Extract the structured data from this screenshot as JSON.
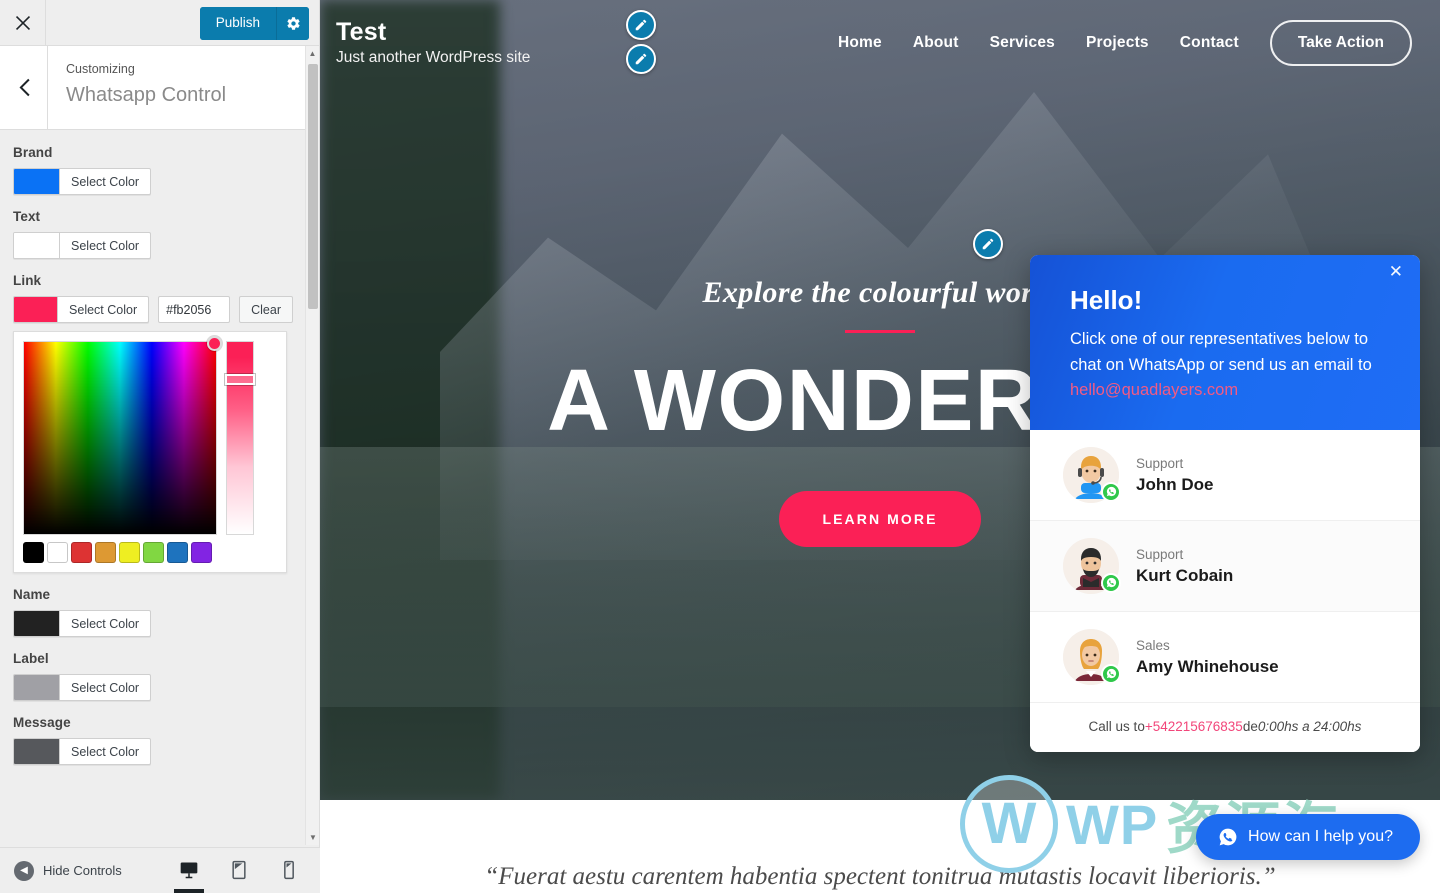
{
  "customizer": {
    "close_icon": "close-icon",
    "publish_label": "Publish",
    "gear_icon": "gear-icon",
    "back_icon": "chevron-left-icon",
    "breadcrumb": "Customizing",
    "panel_title": "Whatsapp Control",
    "select_color_label": "Select Color",
    "clear_label": "Clear",
    "controls": [
      {
        "label": "Brand",
        "color": "#0a72f5",
        "hex": "",
        "has_hex": false
      },
      {
        "label": "Text",
        "color": "#ffffff",
        "hex": "",
        "has_hex": false
      },
      {
        "label": "Link",
        "color": "#fb2056",
        "hex": "#fb2056",
        "has_hex": true
      },
      {
        "label": "Name",
        "color": "#222222",
        "hex": "",
        "has_hex": false
      },
      {
        "label": "Label",
        "color": "#a0a0a5",
        "hex": "",
        "has_hex": false
      },
      {
        "label": "Message",
        "color": "#56585c",
        "hex": "",
        "has_hex": false
      }
    ],
    "picker": {
      "current_color": "#fb2056",
      "swatches": [
        "#000000",
        "#ffffff",
        "#dd3333",
        "#dd9933",
        "#eeee22",
        "#81d742",
        "#1e73be",
        "#8224e3"
      ]
    },
    "footer": {
      "hide_controls_label": "Hide Controls",
      "devices": [
        {
          "name": "desktop",
          "active": true
        },
        {
          "name": "tablet",
          "active": false
        },
        {
          "name": "mobile",
          "active": false
        }
      ]
    }
  },
  "site": {
    "title": "Test",
    "tagline": "Just another WordPress site",
    "nav": [
      "Home",
      "About",
      "Services",
      "Projects",
      "Contact"
    ],
    "cta_label": "Take Action",
    "hero": {
      "subtitle": "Explore the colourful world",
      "heading": "A WONDERFUL",
      "button_label": "LEARN MORE"
    },
    "quote": "“Fuerat aestu carentem habentia spectent tonitrua mutastis locavit liberioris.”"
  },
  "whatsapp": {
    "close_icon": "close-icon",
    "title": "Hello!",
    "message_prefix": "Click one of our representatives below to chat on WhatsApp or send us an email to ",
    "email": "hello@quadlayers.com",
    "agents": [
      {
        "role": "Support",
        "name": "John Doe"
      },
      {
        "role": "Support",
        "name": "Kurt Cobain"
      },
      {
        "role": "Sales",
        "name": "Amy Whinehouse"
      }
    ],
    "footer_prefix": "Call us to",
    "footer_phone": "+542215676835",
    "footer_mid": "de",
    "footer_hours": "0:00hs a 24:00hs",
    "fab_label": "How can I help you?"
  },
  "watermark": {
    "letter": "W",
    "wp": "WP",
    "cn": "资源海"
  }
}
